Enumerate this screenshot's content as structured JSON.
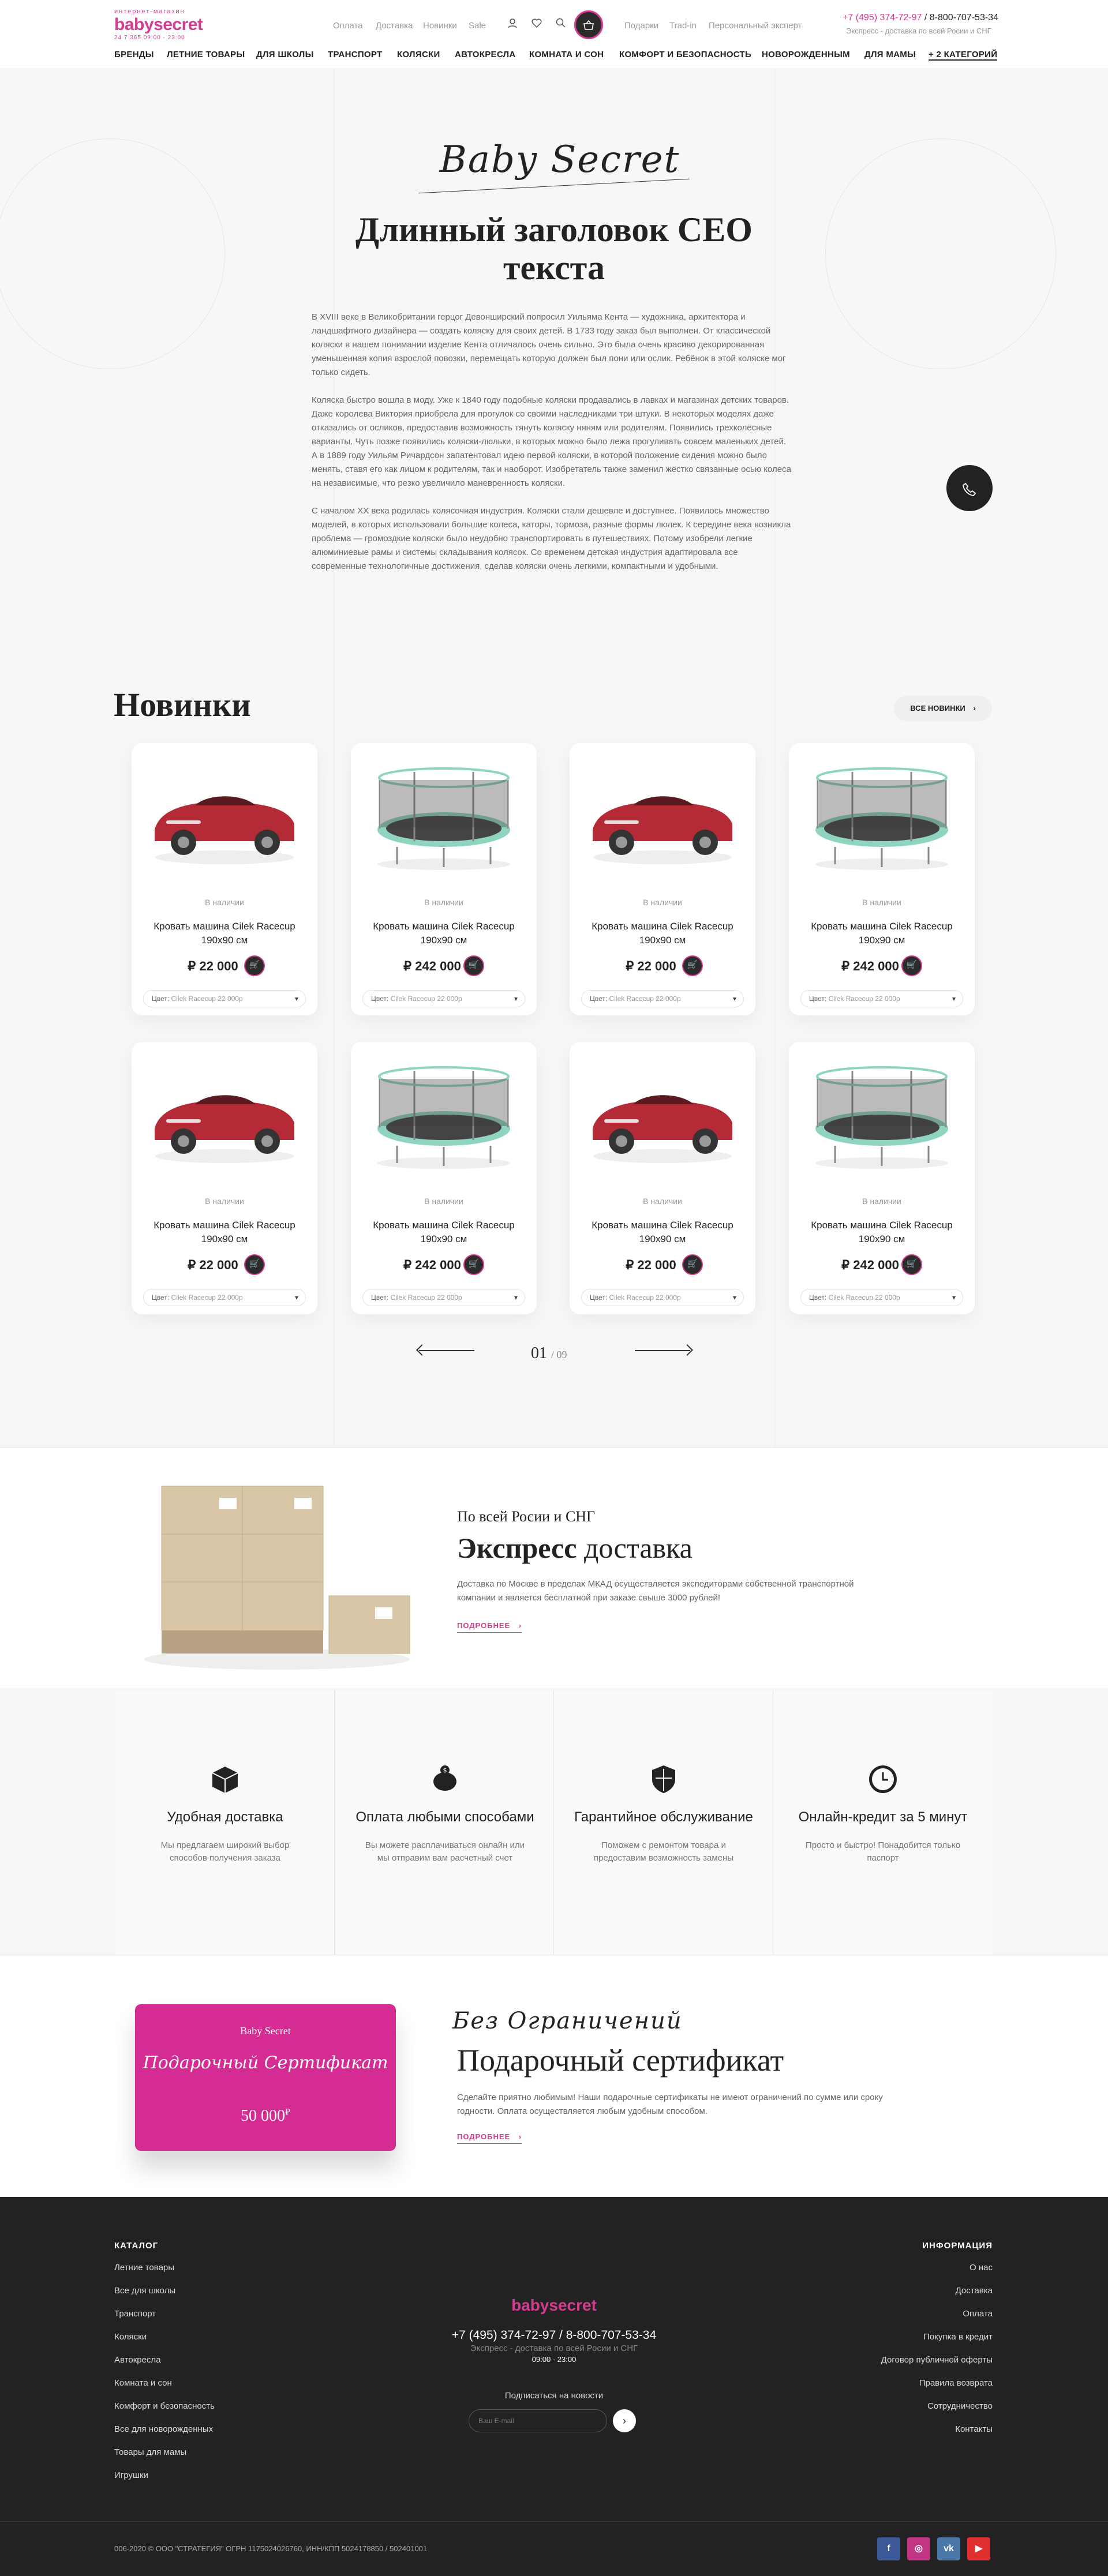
{
  "header": {
    "logo_small": "интернет-магазин",
    "logo_main": "babysecret",
    "logo_sub": "24 7 365  09:00 - 23:00",
    "top_links": [
      "Оплата",
      "Доставка",
      "Новинки",
      "Sale"
    ],
    "top_links2": [
      "Подарки",
      "Trad-in",
      "Персональный эксперт"
    ],
    "phone1": "+7 (495) 374-72-97",
    "phone_sep": " / ",
    "phone2": "8-800-707-53-34",
    "express": "Экспресс - доставка по всей Росии и СНГ",
    "nav": [
      "БРЕНДЫ",
      "ЛЕТНИЕ ТОВАРЫ",
      "ДЛЯ ШКОЛЫ",
      "ТРАНСПОРТ",
      "КОЛЯСКИ",
      "АВТОКРЕСЛА",
      "КОМНАТА И СОН",
      "КОМФОРТ И БЕЗОПАСНОСТЬ",
      "НОВОРОЖДЕННЫМ",
      "ДЛЯ МАМЫ",
      "+ 2 КАТЕГОРИЙ"
    ]
  },
  "seo": {
    "signature": "Baby Secret",
    "title": "Длинный заголовок СЕО текста",
    "paragraphs": [
      "В XVIII веке в Великобритании герцог Девонширский попросил Уильяма Кента — художника, архитектора и ландшафтного дизайнера — создать коляску для своих детей. В 1733 году заказ был выполнен. От классической коляски в нашем понимании изделие Кента отличалось очень сильно. Это была очень красиво декорированная уменьшенная копия взрослой повозки, перемещать которую должен был пони или ослик. Ребёнок в этой коляске мог только сидеть.",
      "Коляска быстро вошла в моду. Уже к 1840 году подобные коляски продавались в лавках и магазинах детских товаров. Даже королева Виктория приобрела для прогулок со своими наследниками три штуки. В некоторых моделях даже отказались от осликов, предоставив возможность тянуть коляску няням или родителям. Появились трехколёсные варианты. Чуть позже появились коляски-люльки, в которых можно было лежа прогуливать совсем маленьких детей. А в 1889 году Уильям Ричардсон запатентовал идею первой коляски, в которой положение сидения можно было менять, ставя его как лицом к родителям, так и наоборот. Изобретатель также заменил жестко связанные осью колеса на независимые, что резко увеличило маневренность коляски.",
      "С началом XX века родилась колясочная индустрия. Коляски стали дешевле и доступнее. Появилось множество моделей, в которых использовали большие колеса, каторы, тормоза, разные формы люлек. К середине века возникла проблема — громоздкие коляски было неудобно транспортировать в путешествиях. Потому изобрели легкие алюминиевые рамы и системы складывания колясок. Со временем детская индустрия адаптировала все современные технологичные достижения, сделав коляски очень легкими, компактными и удобными."
    ]
  },
  "new_section": {
    "title": "Новинки",
    "all_button": "ВСЕ НОВИНКИ",
    "pagination_current": "01",
    "pagination_total": "/ 09"
  },
  "products": [
    {
      "stock": "В наличии",
      "name": "Кровать машина Cilek Racecup 190х90 см",
      "price": "₽ 22 000",
      "color_label": "Цвет:",
      "color_value": "Cilek Racecup 22 000р",
      "kind": "car"
    },
    {
      "stock": "В наличии",
      "name": "Кровать машина Cilek Racecup 190х90 см",
      "price": "₽ 242 000",
      "color_label": "Цвет:",
      "color_value": "Cilek Racecup 22 000р",
      "kind": "trampoline"
    },
    {
      "stock": "В наличии",
      "name": "Кровать машина Cilek Racecup 190х90 см",
      "price": "₽ 22 000",
      "color_label": "Цвет:",
      "color_value": "Cilek Racecup 22 000р",
      "kind": "car"
    },
    {
      "stock": "В наличии",
      "name": "Кровать машина Cilek Racecup 190х90 см",
      "price": "₽ 242 000",
      "color_label": "Цвет:",
      "color_value": "Cilek Racecup 22 000р",
      "kind": "trampoline"
    },
    {
      "stock": "В наличии",
      "name": "Кровать машина Cilek Racecup 190х90 см",
      "price": "₽ 22 000",
      "color_label": "Цвет:",
      "color_value": "Cilek Racecup 22 000р",
      "kind": "car"
    },
    {
      "stock": "В наличии",
      "name": "Кровать машина Cilek Racecup 190х90 см",
      "price": "₽ 242 000",
      "color_label": "Цвет:",
      "color_value": "Cilek Racecup 22 000р",
      "kind": "trampoline"
    },
    {
      "stock": "В наличии",
      "name": "Кровать машина Cilek Racecup 190х90 см",
      "price": "₽ 22 000",
      "color_label": "Цвет:",
      "color_value": "Cilek Racecup 22 000р",
      "kind": "car"
    },
    {
      "stock": "В наличии",
      "name": "Кровать машина Cilek Racecup 190х90 см",
      "price": "₽ 242 000",
      "color_label": "Цвет:",
      "color_value": "Cilek Racecup 22 000р",
      "kind": "trampoline"
    }
  ],
  "delivery": {
    "subtitle": "По всей Росии и СНГ",
    "title_bold": "Экспресс",
    "title_rest": " доставка",
    "text": "Доставка по Москве в пределах МКАД осуществляется экспедиторами собственной транспортной компании и является бесплатной при заказе свыше 3000 рублей!",
    "more": "ПОДРОБНЕЕ"
  },
  "features": [
    {
      "title": "Удобная доставка",
      "text": "Мы предлагаем широкий выбор способов получения заказа",
      "icon": "box-icon"
    },
    {
      "title": "Оплата любыми способами",
      "text": "Вы можете расплачиваться онлайн или мы отправим вам расчетный счет",
      "icon": "piggy-bank-icon"
    },
    {
      "title": "Гарантийное обслуживание",
      "text": "Поможем с ремонтом товара и предоставим возможность замены",
      "icon": "shield-icon"
    },
    {
      "title": "Онлайн-кредит за 5 минут",
      "text": "Просто и быстро! Понадобится только паспорт",
      "icon": "clock-icon"
    }
  ],
  "certificate": {
    "card_brand": "Baby Secret",
    "card_script": "Подарочный Сертификат",
    "card_amount": "50 000",
    "card_currency": "₽",
    "script_title": "Без Ограничений",
    "title": "Подарочный сертификат",
    "text": "Сделайте приятно любимым! Наши подарочные сертификаты не имеют ограничений по сумме или сроку годности. Оплата осуществляется любым удобным способом.",
    "more": "ПОДРОБНЕЕ"
  },
  "footer": {
    "catalog_title": "КАТАЛОГ",
    "catalog": [
      "Летние товары",
      "Все для школы",
      "Транспорт",
      "Коляски",
      "Автокресла",
      "Комната и сон",
      "Комфорт и безопасность",
      "Все для новорожденных",
      "Товары для мамы",
      "Игрушки"
    ],
    "info_title": "ИНФОРМАЦИЯ",
    "info": [
      "О нас",
      "Доставка",
      "Оплата",
      "Покупка в кредит",
      "Договор публичной оферты",
      "Правила возврата",
      "Сотрудничество",
      "Контакты"
    ],
    "logo": "babysecret",
    "phone": "+7 (495) 374-72-97 / 8-800-707-53-34",
    "express": "Экспресс - доставка по всей Росии и СНГ",
    "hours": "09:00 - 23:00",
    "subscribe": "Подписаться на новости",
    "email_placeholder": "Ваш E-mail",
    "copyright": "006-2020 © ООО \"СТРАТЕГИЯ\" ОГРН 1175024026760, ИНН/КПП 5024178850 / 502401001",
    "social": [
      {
        "name": "facebook-icon",
        "glyph": "f",
        "color": "#3b5998"
      },
      {
        "name": "instagram-icon",
        "glyph": "◎",
        "color": "#c13584"
      },
      {
        "name": "vk-icon",
        "glyph": "vk",
        "color": "#4a76a8"
      },
      {
        "name": "youtube-icon",
        "glyph": "▶",
        "color": "#e02f2f"
      }
    ]
  },
  "colors": {
    "accent": "#d23d8f",
    "dark": "#222222"
  }
}
